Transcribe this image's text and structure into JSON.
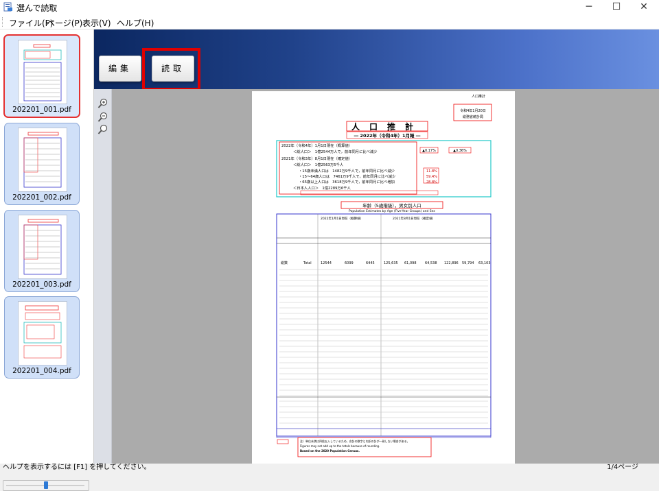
{
  "window": {
    "title": "選んで読取",
    "controls": {
      "minimize": "─",
      "maximize": "☐",
      "close": "✕"
    }
  },
  "menu": [
    "ファイル(F)",
    "ページ(P)",
    "表示(V)",
    "ヘルプ(H)"
  ],
  "thumbnails": [
    {
      "file": "202201_001.pdf",
      "selected": true
    },
    {
      "file": "202201_002.pdf",
      "selected": false
    },
    {
      "file": "202201_003.pdf",
      "selected": false
    },
    {
      "file": "202201_004.pdf",
      "selected": false
    }
  ],
  "toolbar": {
    "edit_label": "編集",
    "read_label": "読取",
    "highlight_color": "#e00000"
  },
  "zoom_icons": [
    "zoom-in-icon",
    "zoom-out-icon",
    "zoom-fit-icon"
  ],
  "document": {
    "stamp": [
      "人口推計",
      "令和4年1月20日",
      "総務省統計局"
    ],
    "main_title": "人口推計",
    "subtitle": "― 2022年（令和4年）1月報 ―",
    "badge1": "▲0.17%",
    "badge2": "▲0.36%",
    "summary": [
      "2022年（令和4年）1月1日現在（概算値）",
      "＜総人口＞　1億2544万人で，前年同月に比べ減少",
      "2021年（令和3年）8月1日現在（確定値）",
      "＜総人口＞　1億2563万5千人",
      "・15歳未満人口は　1482万9千人で，前年同月に比べ減少",
      "・15～64歳人口は　7461万9千人で，前年同月に比べ減少",
      "・65歳以上人口は　3618万9千人で，前年同月に比べ増加",
      "＜日本人人口＞　1億2289万6千人"
    ],
    "pct": [
      "11.8%",
      "59.4%",
      "28.8%"
    ],
    "table_title": "年齢（5歳階級），男女別人口",
    "table_title_en": "Population Estimates by Age (Five-Year Groups) and Sex",
    "table_header_left": "2022年1月1日現在（概算値）",
    "table_header_right": "2021年8月1日現在（確定値）",
    "total_row": [
      "総数",
      "Total",
      "12544",
      "6099",
      "6445",
      "125,635",
      "61,098",
      "64,538",
      "122,896",
      "59,794",
      "63,103"
    ],
    "footnotes": [
      "注）単位未満は四捨五入しているため，合計の数字と内訳の計が一致しない場合がある。",
      "Figures may not add up to the totals because of rounding.",
      "Based on the 2020 Population Census."
    ]
  },
  "status": {
    "help_text": "ヘルプを表示するには [F1] を押してください。",
    "page": "1/4ページ"
  }
}
